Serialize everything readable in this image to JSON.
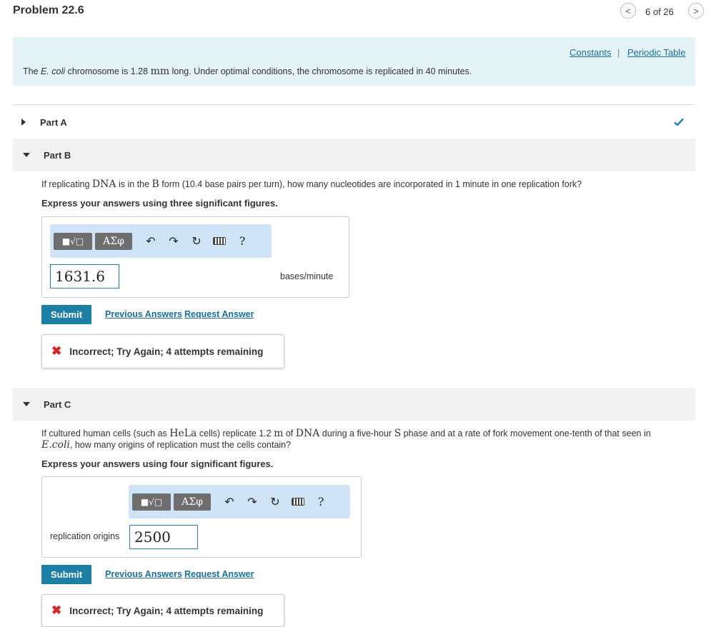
{
  "header": {
    "title": "Problem 22.6",
    "prev_icon": "<",
    "next_icon": ">",
    "counter": "6 of 26"
  },
  "intro": {
    "constants_link": "Constants",
    "separator": "|",
    "periodic_link": "Periodic Table",
    "text_pre": "The ",
    "text_italic": "E. coli",
    "text_mid": " chromosome is 1.28 ",
    "text_unit": "mm",
    "text_post": " long. Under optimal conditions, the chromosome is replicated in 40 minutes."
  },
  "part_a": {
    "label": "Part A",
    "status": "complete"
  },
  "part_b": {
    "label": "Part B",
    "q_pre": "If replicating ",
    "q_dna": "DNA",
    "q_mid": " is in the ",
    "q_b": "B",
    "q_post": " form (10.4 base pairs per turn), how many nucleotides are incorporated in 1 minute in one replication fork?",
    "instruction": "Express your answers using three significant figures.",
    "toolbar": {
      "templates": "■√□",
      "greek": "ΑΣφ",
      "help": "?"
    },
    "answer_value": "1631.6",
    "unit": "bases/minute",
    "submit_label": "Submit",
    "prev_answers": "Previous Answers",
    "request_answer": "Request Answer",
    "feedback": "Incorrect; Try Again; 4 attempts remaining"
  },
  "part_c": {
    "label": "Part C",
    "q_pre": "If cultured human cells (such as ",
    "q_hela": "HeLa",
    "q_mid1": " cells) replicate 1.2 ",
    "q_m": "m",
    "q_mid2": " of ",
    "q_dna": "DNA",
    "q_mid3": " during a five-hour ",
    "q_s": "S",
    "q_mid4": " phase and at a rate of fork movement one-tenth of that seen in",
    "q_ecoli": "E.coli",
    "q_post": ", how many origins of replication must the cells contain?",
    "instruction": "Express your answers using four significant figures.",
    "toolbar": {
      "templates": "■√□",
      "greek": "ΑΣφ",
      "help": "?"
    },
    "input_label": "replication origins",
    "answer_value": "2500",
    "submit_label": "Submit",
    "prev_answers": "Previous Answers",
    "request_answer": "Request Answer",
    "feedback": "Incorrect; Try Again; 4 attempts remaining"
  },
  "colors": {
    "intro_bg": "#e4f3f6",
    "submit_bg": "#1d7ea6",
    "link": "#1a6e9e",
    "error": "#d8232a",
    "success": "#1a7fb0",
    "toolbar_bg": "#cfe5f7"
  }
}
